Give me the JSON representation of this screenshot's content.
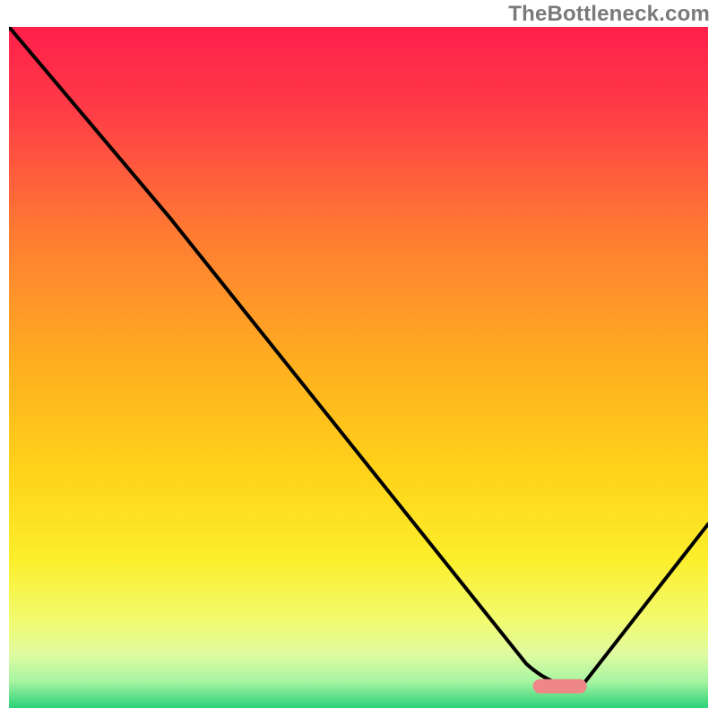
{
  "watermark": "TheBottleneck.com",
  "chart_data": {
    "type": "line",
    "title": "",
    "xlabel": "",
    "ylabel": "",
    "x_range": [
      0,
      100
    ],
    "y_range": [
      0,
      100
    ],
    "series": [
      {
        "name": "bottleneck-curve",
        "x": [
          0,
          23,
          74,
          82,
          100
        ],
        "y": [
          100,
          72,
          6.5,
          3.3,
          27
        ]
      }
    ],
    "marker": {
      "name": "optimal-marker",
      "x_center": 78.8,
      "y_center": 3.2,
      "width": 7.7,
      "height": 2.1,
      "color": "#ef8688"
    },
    "background_gradient": {
      "direction": "vertical",
      "stops": [
        {
          "pos": 0.0,
          "color": "#ff1f4b"
        },
        {
          "pos": 0.12,
          "color": "#ff3b47"
        },
        {
          "pos": 0.3,
          "color": "#ff7a33"
        },
        {
          "pos": 0.5,
          "color": "#ffb01f"
        },
        {
          "pos": 0.65,
          "color": "#ffd21a"
        },
        {
          "pos": 0.78,
          "color": "#fcee2a"
        },
        {
          "pos": 0.87,
          "color": "#f2fb6e"
        },
        {
          "pos": 0.92,
          "color": "#e0fba0"
        },
        {
          "pos": 0.96,
          "color": "#a9f5a2"
        },
        {
          "pos": 1.0,
          "color": "#2bd17a"
        }
      ]
    },
    "curve_style": {
      "stroke": "#000000",
      "width": 4
    },
    "grid": false,
    "legend": false,
    "ticks": false
  }
}
